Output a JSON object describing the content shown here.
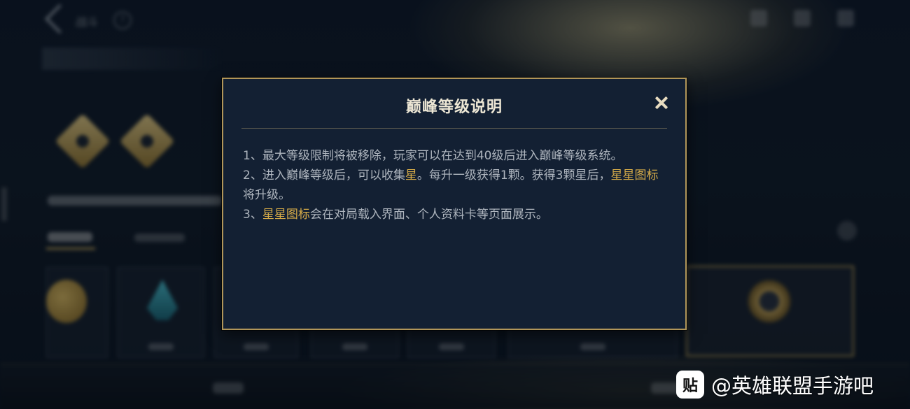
{
  "background": {
    "back_label": "战斗",
    "help_glyph": "?"
  },
  "dialog": {
    "title": "巅峰等级说明",
    "lines": [
      {
        "text_before": "1、最大等级限制将被移除，玩家可以在达到40级后进入巅峰等级系统。"
      },
      {
        "text_before": "2、进入巅峰等级后，可以收集",
        "highlight_1": "星",
        "text_middle": "。每升一级获得1颗。获得3颗星后，",
        "highlight_2": "星星图标",
        "text_after": "将升级。"
      },
      {
        "text_before": "3、",
        "highlight_1": "星星图标",
        "text_after": "会在对局载入界面、个人资料卡等页面展示。"
      }
    ]
  },
  "watermark": {
    "logo_glyph": "贴",
    "text": "@英雄联盟手游吧"
  },
  "colors": {
    "accent_gold": "#d6ab48",
    "border_gold": "#b19659",
    "dialog_bg": "#132033"
  },
  "icons": {
    "close": "close-icon",
    "back": "back-arrow-icon"
  }
}
